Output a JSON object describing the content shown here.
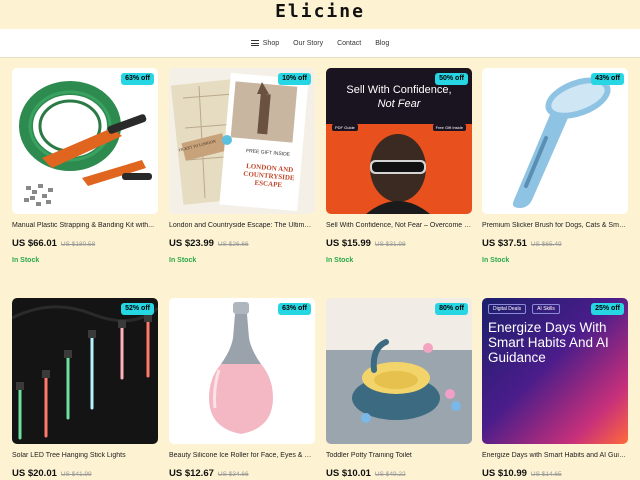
{
  "brand": {
    "name": "Elicine"
  },
  "nav": [
    {
      "label": "Shop",
      "icon": "menu-icon"
    },
    {
      "label": "Our Story"
    },
    {
      "label": "Contact"
    },
    {
      "label": "Blog"
    }
  ],
  "products": [
    {
      "title": "Manual Plastic Strapping & Banding Kit with...",
      "price": "US $66.01",
      "old_price": "US $180.58",
      "discount": "63% off",
      "stock": "In Stock"
    },
    {
      "title": "London and Countryside Escape: The Ultimate U...",
      "price": "US $23.99",
      "old_price": "US $26.66",
      "discount": "10% off",
      "stock": "In Stock",
      "cover_label": "FREE GIFT INSIDE",
      "cover_title": "LONDON AND COUNTRYSIDE ESCAPE",
      "ticket_text": "TICKET TO LONDON"
    },
    {
      "title": "Sell With Confidence, Not Fear – Overcome the...",
      "price": "US $15.99",
      "old_price": "US $31.98",
      "discount": "50% off",
      "stock": "In Stock",
      "cover_line1": "Sell With Confidence,",
      "cover_line2": "Not Fear",
      "tag_left": "PDF Guide",
      "tag_right": "Free Gift Inside"
    },
    {
      "title": "Premium Slicker Brush for Dogs, Cats & Small...",
      "price": "US $37.51",
      "old_price": "US $65.49",
      "discount": "43% off",
      "stock": "In Stock"
    },
    {
      "title": "Solar LED Tree Hanging Stick Lights",
      "price": "US $20.01",
      "old_price": "US $41.99",
      "discount": "52% off"
    },
    {
      "title": "Beauty Silicone Ice Roller for Face, Eyes & Body",
      "price": "US $12.67",
      "old_price": "US $34.66",
      "discount": "63% off"
    },
    {
      "title": "Toddler Potty Training Toilet",
      "price": "US $10.01",
      "old_price": "US $49.22",
      "discount": "80% off"
    },
    {
      "title": "Energize Days with Smart Habits and AI Guidan...",
      "price": "US $10.99",
      "old_price": "US $14.65",
      "discount": "25% off",
      "tabs": [
        "Digital Deals",
        "AI Skills"
      ],
      "cover_text": "Energize Days With Smart Habits And AI Guidance"
    }
  ],
  "colors": {
    "background": "#fdf3d3",
    "badge": "#27d6e3",
    "in_stock": "#2aa84a"
  }
}
